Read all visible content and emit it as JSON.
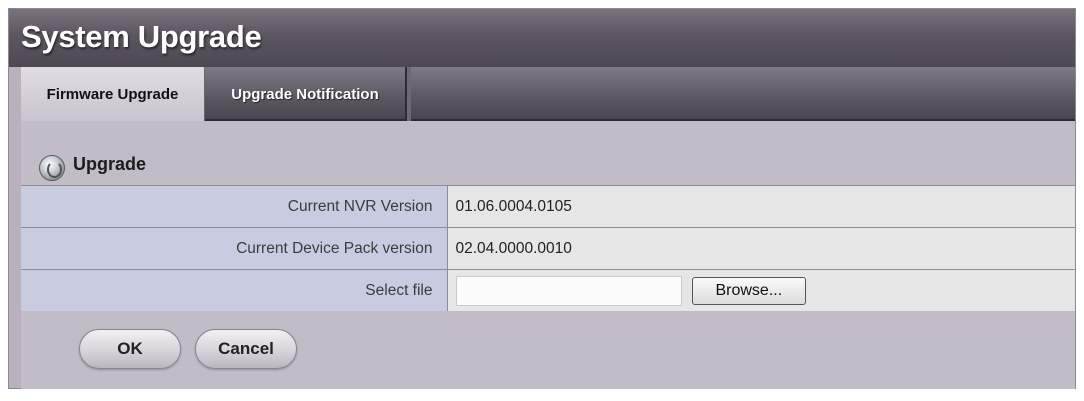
{
  "window": {
    "title": "System Upgrade"
  },
  "tabs": [
    {
      "label": "Firmware Upgrade",
      "active": true
    },
    {
      "label": "Upgrade Notification",
      "active": false
    }
  ],
  "section": {
    "title": "Upgrade",
    "icon": "upgrade-disc-icon"
  },
  "form": {
    "rows": [
      {
        "label": "Current NVR Version",
        "value": "01.06.0004.0105"
      },
      {
        "label": "Current Device Pack version",
        "value": "02.04.0000.0010"
      },
      {
        "label": "Select file",
        "value": ""
      }
    ],
    "browse_label": "Browse..."
  },
  "actions": {
    "ok_label": "OK",
    "cancel_label": "Cancel"
  },
  "colors": {
    "panel_background": "#b9b2be",
    "label_cell": "#c9cce0",
    "value_cell": "#e6e6e6",
    "title_bar": "#5d5661"
  }
}
